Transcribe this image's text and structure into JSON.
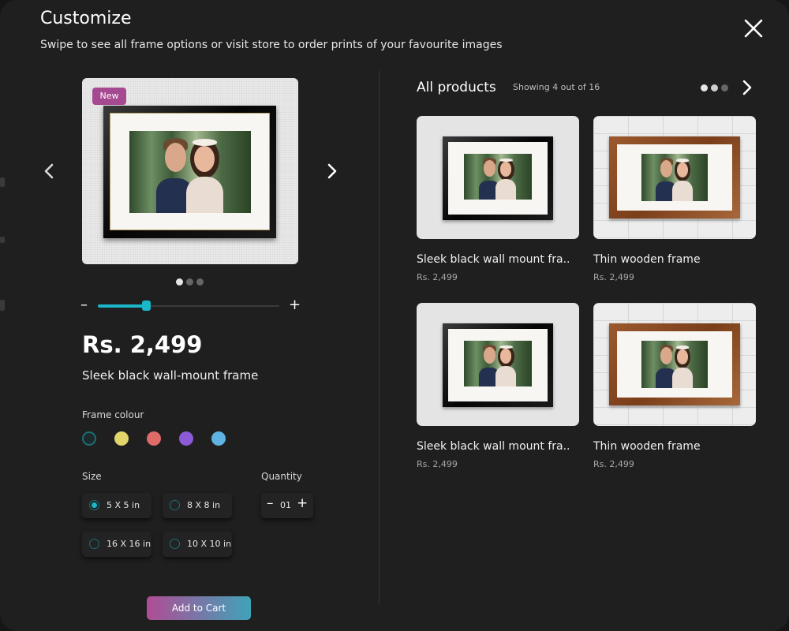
{
  "header": {
    "title": "Customize",
    "subtitle": "Swipe to see all frame options or visit store to order prints of your favourite images",
    "close_icon": "close-icon"
  },
  "preview": {
    "badge": "New",
    "carousel_pages": 3,
    "carousel_active": 1,
    "zoom_level_percent": 27
  },
  "product": {
    "price": "Rs. 2,499",
    "name": "Sleek black wall-mount frame"
  },
  "frame_colour": {
    "label": "Frame colour",
    "options": [
      "#1c2a2d",
      "#e4d56b",
      "#de6b67",
      "#8c5ad6",
      "#5fb3e2"
    ],
    "selected": 0
  },
  "size": {
    "label": "Size",
    "options": [
      "5 X 5 in",
      "8 X 8 in",
      "16 X 16 in",
      "10 X 10 in"
    ],
    "selected": "5 X 5 in"
  },
  "quantity": {
    "label": "Quantity",
    "value": "01"
  },
  "cart": {
    "button_label": "Add to Cart"
  },
  "products": {
    "title": "All products",
    "count_text": "Showing 4 out of 16",
    "carousel_pages": 3,
    "carousel_active": 1,
    "items": [
      {
        "name": "Sleek black wall mount fra..",
        "price": "Rs. 2,499"
      },
      {
        "name": "Thin wooden frame",
        "price": "Rs. 2,499"
      },
      {
        "name": "Sleek black wall mount fra..",
        "price": "Rs. 2,499"
      },
      {
        "name": "Thin wooden frame",
        "price": "Rs. 2,499"
      }
    ]
  },
  "colors": {
    "accent": "#19b7c8",
    "badge": "#a54a91",
    "cta_start": "#b04c95",
    "cta_end": "#3fa3b9",
    "background": "#1f1f1f"
  }
}
